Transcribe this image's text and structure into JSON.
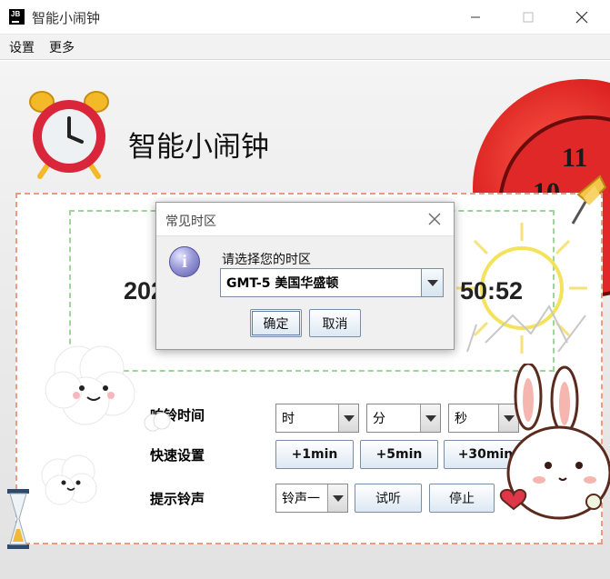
{
  "window": {
    "title": "智能小闹钟",
    "logo_text": "JB"
  },
  "menu": [
    {
      "label": "设置"
    },
    {
      "label": "更多"
    }
  ],
  "header": {
    "title": "智能小闹钟"
  },
  "clock": {
    "time_left": "202",
    "time_right": "50:52"
  },
  "controls": {
    "ring_time_label": "响铃时间",
    "hour_value": "时",
    "minute_value": "分",
    "second_value": "秒",
    "quick_set_label": "快速设置",
    "quick_buttons": [
      {
        "label": "+1min"
      },
      {
        "label": "+5min"
      },
      {
        "label": "+30min"
      }
    ],
    "ringtone_label": "提示铃声",
    "ringtone_value": "铃声一",
    "preview_button": "试听",
    "stop_button": "停止"
  },
  "dialog": {
    "title": "常见时区",
    "prompt": "请选择您的时区",
    "selected": "GMT-5 美国华盛顿",
    "ok_button": "确定",
    "cancel_button": "取消",
    "icon_glyph": "i"
  },
  "decor": {
    "clock_numbers": [
      "11",
      "10"
    ]
  },
  "colors": {
    "panel_border": "#ec9a84",
    "time_border": "#9fd49a",
    "alarm_red": "#d9263a",
    "alarm_yellow": "#f3b928"
  }
}
